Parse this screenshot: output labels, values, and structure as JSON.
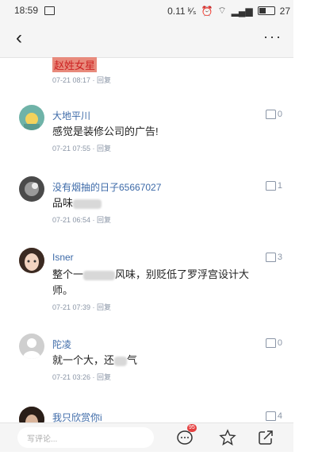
{
  "status": {
    "time": "18:59",
    "right": "0.11 ⁰/ₛ ⏰ ⌔ 🔈 27"
  },
  "nav": {
    "back": "‹",
    "more": "···"
  },
  "highlight": {
    "name": "赵姓女星",
    "meta": "07-21 08:17 · 回复"
  },
  "comments": [
    {
      "name": "大地平川",
      "likes": "0",
      "text": "感觉是装修公司的广告!",
      "meta": "07-21 07:55 · 回复",
      "avatar_color": "#6fb3a8"
    },
    {
      "name": "没有烟抽的日子65667027",
      "likes": "1",
      "text": "品味",
      "meta": "07-21 06:54 · 回复",
      "avatar_color": "#4a4a4a"
    },
    {
      "name": "Isner",
      "likes": "3",
      "text1": "整个一",
      "text2": "风味，别贬低了罗浮宫设计大",
      "text3": "师。",
      "meta": "07-21 07:39 · 回复",
      "avatar_color": "#c89b7c"
    },
    {
      "name": "陀凌",
      "likes": "0",
      "text1": "就一个大，还",
      "text2": "气",
      "meta": "07-21 03:26 · 回复",
      "avatar_color": "#cfcfcf"
    },
    {
      "name": "我只欣赏你i",
      "likes": "4",
      "avatar_color": "#6a4a3a"
    }
  ],
  "bottom": {
    "placeholder": "写评论...",
    "badge": "95"
  }
}
